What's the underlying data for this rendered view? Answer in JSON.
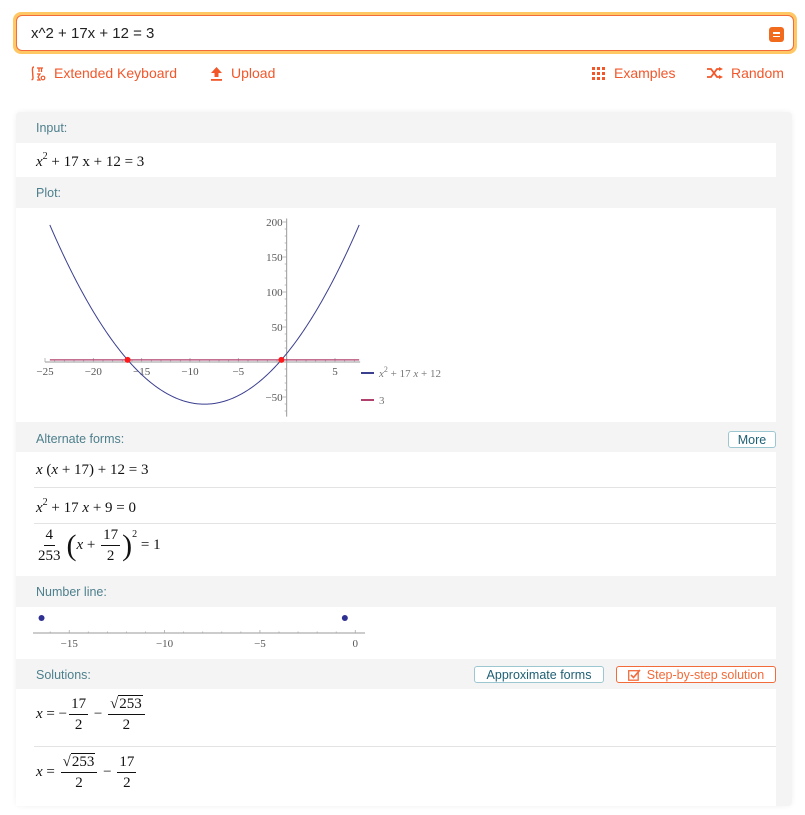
{
  "search": {
    "value": "x^2 + 17x + 12 = 3",
    "submit_icon": "equals-icon"
  },
  "toolbar": {
    "extended_keyboard": {
      "label": "Extended Keyboard",
      "icon": "math-symbols-icon"
    },
    "upload": {
      "label": "Upload",
      "icon": "upload-arrow-icon"
    },
    "examples": {
      "label": "Examples",
      "icon": "dot-grid-icon"
    },
    "random": {
      "label": "Random",
      "icon": "shuffle-icon"
    }
  },
  "pods": {
    "input": {
      "title": "Input:",
      "expr": {
        "base": "x",
        "exp": "2",
        "rest": " + 17 x + 12 = 3"
      }
    },
    "plot": {
      "title": "Plot:",
      "legend": [
        {
          "label_base": "x",
          "label_exp": "2",
          "label_rest": " + 17 x + 12",
          "color": "#3b3f8f"
        },
        {
          "label_base": "",
          "label_exp": "",
          "label_rest": "3",
          "color": "#b0406d"
        }
      ]
    },
    "alternate_forms": {
      "title": "Alternate forms:",
      "more_label": "More",
      "forms": [
        "x (x + 17) + 12 = 3",
        "x^2 + 17 x + 9 = 0",
        "4/253 (x + 17/2)^2 = 1"
      ],
      "form1": {
        "a": "x",
        "b": " (",
        "c": "x",
        "d": " + 17) + 12 = 3"
      },
      "form2": {
        "a": "x",
        "exp": "2",
        "b": " + 17 ",
        "c": "x",
        "d": " + 9 = 0"
      },
      "form3": {
        "num1": "4",
        "den1": "253",
        "open": "(",
        "x": "x",
        "plus": " + ",
        "num2": "17",
        "den2": "2",
        "close": ")",
        "exp": "2",
        "rhs": " = 1"
      }
    },
    "number_line": {
      "title": "Number line:",
      "ticks": [
        "−15",
        "−10",
        "−5",
        "0"
      ]
    },
    "solutions": {
      "title": "Solutions:",
      "approx_label": "Approximate forms",
      "step_label": "Step-by-step solution",
      "sol1": {
        "x": "x",
        "eq": " = −",
        "num1": "17",
        "den1": "2",
        "minus": " − ",
        "rad": "253",
        "den2": "2"
      },
      "sol2": {
        "x": "x",
        "eq": " = ",
        "rad": "253",
        "den1": "2",
        "minus": " − ",
        "num2": "17",
        "den2": "2"
      }
    }
  },
  "chart_data": {
    "type": "line",
    "title": "",
    "xlabel": "",
    "ylabel": "",
    "xlim": [
      -25,
      7.5
    ],
    "ylim": [
      -70,
      210
    ],
    "x_ticks": [
      -25,
      -20,
      -15,
      -10,
      -5,
      5
    ],
    "x_tick_labels": [
      "−25",
      "−20",
      "−15",
      "−10",
      "−5",
      "5"
    ],
    "y_ticks": [
      200,
      150,
      100,
      50,
      -50
    ],
    "y_tick_labels": [
      "200",
      "150",
      "100",
      "50",
      "−50"
    ],
    "series": [
      {
        "name": "x^2 + 17 x + 12",
        "function": "x^2 + 17x + 12",
        "x_range": [
          -24.5,
          7.5
        ],
        "color": "#3b3f8f"
      },
      {
        "name": "3",
        "function": "3",
        "x_range": [
          -24.5,
          7.5
        ],
        "color": "#b0406d"
      }
    ],
    "intersections": [
      {
        "x": -16.4529,
        "y": 3
      },
      {
        "x": -0.547,
        "y": 3
      }
    ],
    "legend_position": "right",
    "grid": false
  },
  "number_line_data": {
    "xlim": [
      -16.9,
      0.3
    ],
    "ticks": [
      -15,
      -10,
      -5,
      0
    ],
    "points": [
      -16.4529,
      -0.547
    ],
    "point_color": "#2e3192"
  }
}
